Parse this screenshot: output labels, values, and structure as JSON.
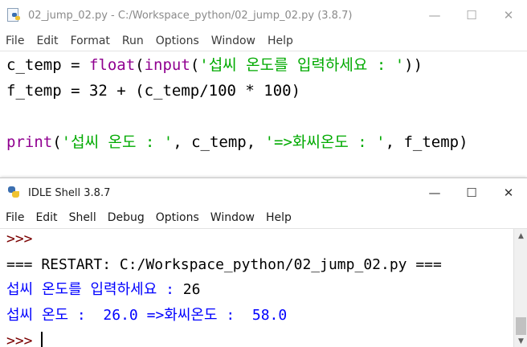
{
  "editor": {
    "title": "02_jump_02.py - C:/Workspace_python/02_jump_02.py (3.8.7)",
    "menu": [
      "File",
      "Edit",
      "Format",
      "Run",
      "Options",
      "Window",
      "Help"
    ],
    "window_controls": {
      "minimize": "—",
      "maximize": "☐",
      "close": "✕"
    },
    "code": {
      "line1": {
        "a": "c_temp = ",
        "b": "float",
        "c": "(",
        "d": "input",
        "e": "(",
        "f": "'섭씨 온도를 입력하세요 : '",
        "g": "))"
      },
      "line2": {
        "a": "f_temp = 32 + (c_temp/100 * 100)"
      },
      "line4": {
        "a": "print",
        "b": "(",
        "c": "'섭씨 온도 : '",
        "d": ", c_temp, ",
        "e": "'=>화씨온도 : '",
        "f": ", f_temp)"
      }
    }
  },
  "shell": {
    "title": "IDLE Shell 3.8.7",
    "menu": [
      "File",
      "Edit",
      "Shell",
      "Debug",
      "Options",
      "Window",
      "Help"
    ],
    "window_controls": {
      "minimize": "—",
      "maximize": "☐",
      "close": "✕"
    },
    "lines": {
      "prompt1": ">>>",
      "restart": "=== RESTART: C:/Workspace_python/02_jump_02.py ===",
      "input_prompt": "섭씨 온도를 입력하세요 : ",
      "input_value": "26",
      "output": "섭씨 온도 :  26.0 =>화씨온도 :  58.0",
      "prompt2": ">>>"
    }
  },
  "colors": {
    "keyword": "#900090",
    "string": "#00aa00",
    "stdout": "#0000ff",
    "prompt": "#7a0000"
  },
  "icons": {
    "editor_title_icon": "python-file-icon",
    "shell_title_icon": "python-icon"
  }
}
